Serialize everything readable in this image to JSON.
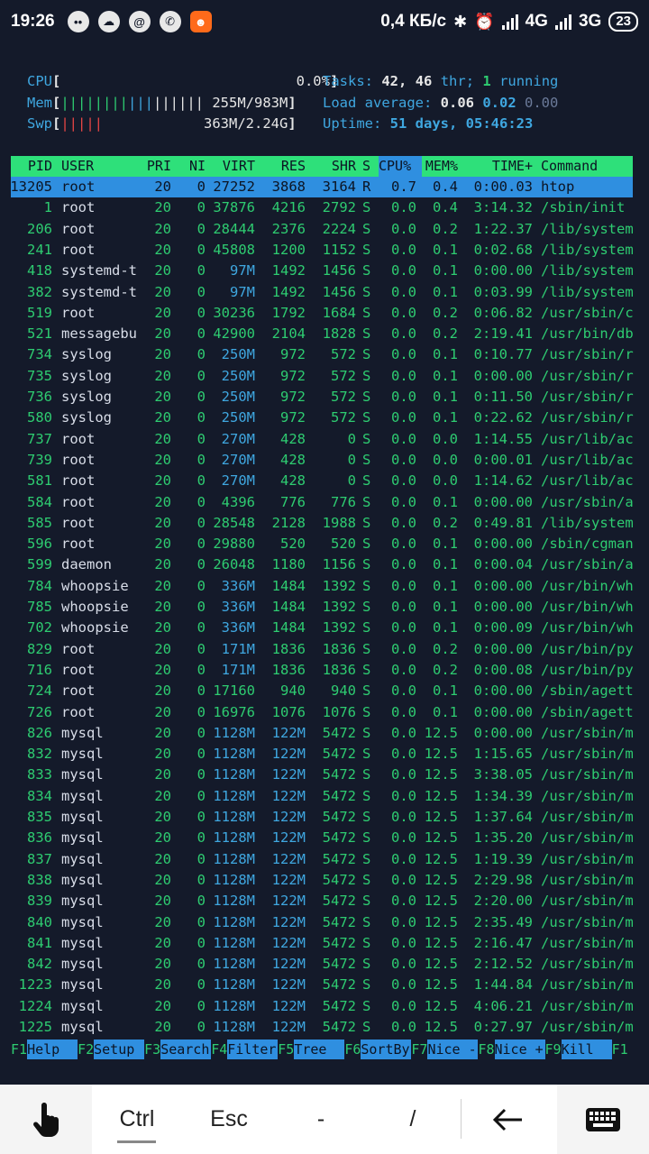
{
  "status_bar": {
    "time": "19:26",
    "notification_icons": [
      "chat-bubble-icon",
      "cloud-icon",
      "at-sign-icon",
      "viber-icon",
      "app-face-icon"
    ],
    "net_speed": "0,4 КБ/с",
    "network1": "4G",
    "network2": "3G",
    "battery": "23"
  },
  "meters": {
    "cpu": {
      "label": "CPU",
      "value": "0.0%"
    },
    "mem": {
      "label": "Mem",
      "value": "255M/983M"
    },
    "swp": {
      "label": "Swp",
      "value": "363M/2.24G"
    }
  },
  "info": {
    "tasks_label": "Tasks:",
    "tasks": "42,",
    "threads": "46",
    "thr_label": "thr;",
    "running": "1",
    "running_label": "running",
    "load_label": "Load average:",
    "load1": "0.06",
    "load5": "0.02",
    "load15": "0.00",
    "uptime_label": "Uptime:",
    "uptime": "51 days, 05:46:23"
  },
  "columns": [
    "PID",
    "USER",
    "PRI",
    "NI",
    "VIRT",
    "RES",
    "SHR",
    "S",
    "CPU%",
    "MEM%",
    "TIME+",
    "Command"
  ],
  "processes": [
    [
      "13205",
      "root",
      "20",
      "0",
      "27252",
      "3868",
      "3164",
      "R",
      "0.7",
      "0.4",
      "0:00.03",
      "htop"
    ],
    [
      "1",
      "root",
      "20",
      "0",
      "37876",
      "4216",
      "2792",
      "S",
      "0.0",
      "0.4",
      "3:14.32",
      "/sbin/init"
    ],
    [
      "206",
      "root",
      "20",
      "0",
      "28444",
      "2376",
      "2224",
      "S",
      "0.0",
      "0.2",
      "1:22.37",
      "/lib/system"
    ],
    [
      "241",
      "root",
      "20",
      "0",
      "45808",
      "1200",
      "1152",
      "S",
      "0.0",
      "0.1",
      "0:02.68",
      "/lib/system"
    ],
    [
      "418",
      "systemd-t",
      "20",
      "0",
      "97M",
      "1492",
      "1456",
      "S",
      "0.0",
      "0.1",
      "0:00.00",
      "/lib/system"
    ],
    [
      "382",
      "systemd-t",
      "20",
      "0",
      "97M",
      "1492",
      "1456",
      "S",
      "0.0",
      "0.1",
      "0:03.99",
      "/lib/system"
    ],
    [
      "519",
      "root",
      "20",
      "0",
      "30236",
      "1792",
      "1684",
      "S",
      "0.0",
      "0.2",
      "0:06.82",
      "/usr/sbin/c"
    ],
    [
      "521",
      "messagebu",
      "20",
      "0",
      "42900",
      "2104",
      "1828",
      "S",
      "0.0",
      "0.2",
      "2:19.41",
      "/usr/bin/db"
    ],
    [
      "734",
      "syslog",
      "20",
      "0",
      "250M",
      "972",
      "572",
      "S",
      "0.0",
      "0.1",
      "0:10.77",
      "/usr/sbin/r"
    ],
    [
      "735",
      "syslog",
      "20",
      "0",
      "250M",
      "972",
      "572",
      "S",
      "0.0",
      "0.1",
      "0:00.00",
      "/usr/sbin/r"
    ],
    [
      "736",
      "syslog",
      "20",
      "0",
      "250M",
      "972",
      "572",
      "S",
      "0.0",
      "0.1",
      "0:11.50",
      "/usr/sbin/r"
    ],
    [
      "580",
      "syslog",
      "20",
      "0",
      "250M",
      "972",
      "572",
      "S",
      "0.0",
      "0.1",
      "0:22.62",
      "/usr/sbin/r"
    ],
    [
      "737",
      "root",
      "20",
      "0",
      "270M",
      "428",
      "0",
      "S",
      "0.0",
      "0.0",
      "1:14.55",
      "/usr/lib/ac"
    ],
    [
      "739",
      "root",
      "20",
      "0",
      "270M",
      "428",
      "0",
      "S",
      "0.0",
      "0.0",
      "0:00.01",
      "/usr/lib/ac"
    ],
    [
      "581",
      "root",
      "20",
      "0",
      "270M",
      "428",
      "0",
      "S",
      "0.0",
      "0.0",
      "1:14.62",
      "/usr/lib/ac"
    ],
    [
      "584",
      "root",
      "20",
      "0",
      "4396",
      "776",
      "776",
      "S",
      "0.0",
      "0.1",
      "0:00.00",
      "/usr/sbin/a"
    ],
    [
      "585",
      "root",
      "20",
      "0",
      "28548",
      "2128",
      "1988",
      "S",
      "0.0",
      "0.2",
      "0:49.81",
      "/lib/system"
    ],
    [
      "596",
      "root",
      "20",
      "0",
      "29880",
      "520",
      "520",
      "S",
      "0.0",
      "0.1",
      "0:00.00",
      "/sbin/cgman"
    ],
    [
      "599",
      "daemon",
      "20",
      "0",
      "26048",
      "1180",
      "1156",
      "S",
      "0.0",
      "0.1",
      "0:00.04",
      "/usr/sbin/a"
    ],
    [
      "784",
      "whoopsie",
      "20",
      "0",
      "336M",
      "1484",
      "1392",
      "S",
      "0.0",
      "0.1",
      "0:00.00",
      "/usr/bin/wh"
    ],
    [
      "785",
      "whoopsie",
      "20",
      "0",
      "336M",
      "1484",
      "1392",
      "S",
      "0.0",
      "0.1",
      "0:00.00",
      "/usr/bin/wh"
    ],
    [
      "702",
      "whoopsie",
      "20",
      "0",
      "336M",
      "1484",
      "1392",
      "S",
      "0.0",
      "0.1",
      "0:00.09",
      "/usr/bin/wh"
    ],
    [
      "829",
      "root",
      "20",
      "0",
      "171M",
      "1836",
      "1836",
      "S",
      "0.0",
      "0.2",
      "0:00.00",
      "/usr/bin/py"
    ],
    [
      "716",
      "root",
      "20",
      "0",
      "171M",
      "1836",
      "1836",
      "S",
      "0.0",
      "0.2",
      "0:00.08",
      "/usr/bin/py"
    ],
    [
      "724",
      "root",
      "20",
      "0",
      "17160",
      "940",
      "940",
      "S",
      "0.0",
      "0.1",
      "0:00.00",
      "/sbin/agett"
    ],
    [
      "726",
      "root",
      "20",
      "0",
      "16976",
      "1076",
      "1076",
      "S",
      "0.0",
      "0.1",
      "0:00.00",
      "/sbin/agett"
    ],
    [
      "826",
      "mysql",
      "20",
      "0",
      "1128M",
      "122M",
      "5472",
      "S",
      "0.0",
      "12.5",
      "0:00.00",
      "/usr/sbin/m"
    ],
    [
      "832",
      "mysql",
      "20",
      "0",
      "1128M",
      "122M",
      "5472",
      "S",
      "0.0",
      "12.5",
      "1:15.65",
      "/usr/sbin/m"
    ],
    [
      "833",
      "mysql",
      "20",
      "0",
      "1128M",
      "122M",
      "5472",
      "S",
      "0.0",
      "12.5",
      "3:38.05",
      "/usr/sbin/m"
    ],
    [
      "834",
      "mysql",
      "20",
      "0",
      "1128M",
      "122M",
      "5472",
      "S",
      "0.0",
      "12.5",
      "1:34.39",
      "/usr/sbin/m"
    ],
    [
      "835",
      "mysql",
      "20",
      "0",
      "1128M",
      "122M",
      "5472",
      "S",
      "0.0",
      "12.5",
      "1:37.64",
      "/usr/sbin/m"
    ],
    [
      "836",
      "mysql",
      "20",
      "0",
      "1128M",
      "122M",
      "5472",
      "S",
      "0.0",
      "12.5",
      "1:35.20",
      "/usr/sbin/m"
    ],
    [
      "837",
      "mysql",
      "20",
      "0",
      "1128M",
      "122M",
      "5472",
      "S",
      "0.0",
      "12.5",
      "1:19.39",
      "/usr/sbin/m"
    ],
    [
      "838",
      "mysql",
      "20",
      "0",
      "1128M",
      "122M",
      "5472",
      "S",
      "0.0",
      "12.5",
      "2:29.98",
      "/usr/sbin/m"
    ],
    [
      "839",
      "mysql",
      "20",
      "0",
      "1128M",
      "122M",
      "5472",
      "S",
      "0.0",
      "12.5",
      "2:20.00",
      "/usr/sbin/m"
    ],
    [
      "840",
      "mysql",
      "20",
      "0",
      "1128M",
      "122M",
      "5472",
      "S",
      "0.0",
      "12.5",
      "2:35.49",
      "/usr/sbin/m"
    ],
    [
      "841",
      "mysql",
      "20",
      "0",
      "1128M",
      "122M",
      "5472",
      "S",
      "0.0",
      "12.5",
      "2:16.47",
      "/usr/sbin/m"
    ],
    [
      "842",
      "mysql",
      "20",
      "0",
      "1128M",
      "122M",
      "5472",
      "S",
      "0.0",
      "12.5",
      "2:12.52",
      "/usr/sbin/m"
    ],
    [
      "1223",
      "mysql",
      "20",
      "0",
      "1128M",
      "122M",
      "5472",
      "S",
      "0.0",
      "12.5",
      "1:44.84",
      "/usr/sbin/m"
    ],
    [
      "1224",
      "mysql",
      "20",
      "0",
      "1128M",
      "122M",
      "5472",
      "S",
      "0.0",
      "12.5",
      "4:06.21",
      "/usr/sbin/m"
    ],
    [
      "1225",
      "mysql",
      "20",
      "0",
      "1128M",
      "122M",
      "5472",
      "S",
      "0.0",
      "12.5",
      "0:27.97",
      "/usr/sbin/m"
    ]
  ],
  "function_keys": [
    {
      "num": "F1",
      "label": "Help"
    },
    {
      "num": "F2",
      "label": "Setup"
    },
    {
      "num": "F3",
      "label": "Search"
    },
    {
      "num": "F4",
      "label": "Filter"
    },
    {
      "num": "F5",
      "label": "Tree"
    },
    {
      "num": "F6",
      "label": "SortBy"
    },
    {
      "num": "F7",
      "label": "Nice -"
    },
    {
      "num": "F8",
      "label": "Nice +"
    },
    {
      "num": "F9",
      "label": "Kill"
    },
    {
      "num": "F1",
      "label": ""
    }
  ],
  "keybar": {
    "touch_icon": "hand-pointer-icon",
    "ctrl": "Ctrl",
    "esc": "Esc",
    "dash": "-",
    "slash": "/",
    "back_icon": "left-arrow-icon",
    "keyboard_icon": "keyboard-icon"
  },
  "colors": {
    "background": "#141a2a",
    "green": "#2ecc71",
    "blue": "#2f8fe0",
    "header": "#2ee07a"
  }
}
